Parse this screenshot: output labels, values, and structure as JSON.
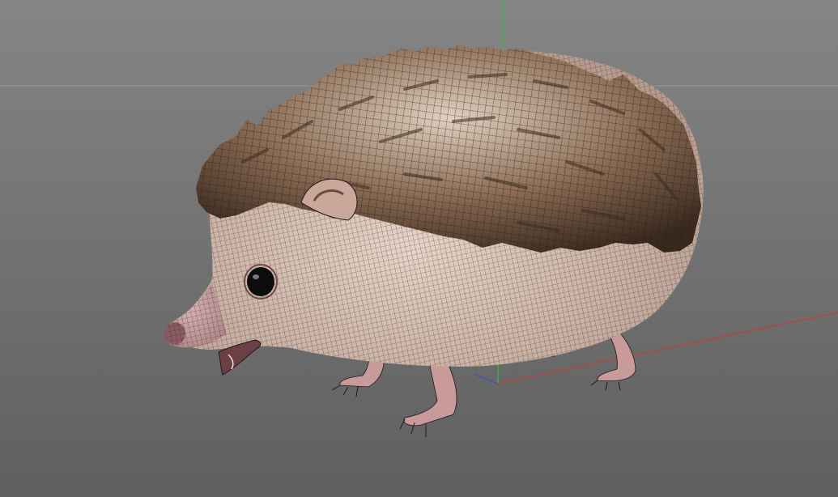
{
  "viewport": {
    "background_top": "#858585",
    "background_bottom": "#5f5f5f",
    "horizon_color": "#9a9a9a"
  },
  "axes": {
    "x_axis_color": "#c83a3a",
    "y_axis_color": "#2fbf3a",
    "z_axis_color": "#3a4fd0"
  },
  "model": {
    "wireframe_color": "#1a1a1a",
    "body_color": "#e7d3c7",
    "body_shadow_color": "#b79c8e",
    "spine_color": "#8a6a52",
    "spine_dark_color": "#3a2a1e",
    "spine_light_color": "#e0d0bf",
    "snout_color": "#b18587",
    "eye_color": "#0d0d0d",
    "leg_color": "#c89a9a"
  }
}
